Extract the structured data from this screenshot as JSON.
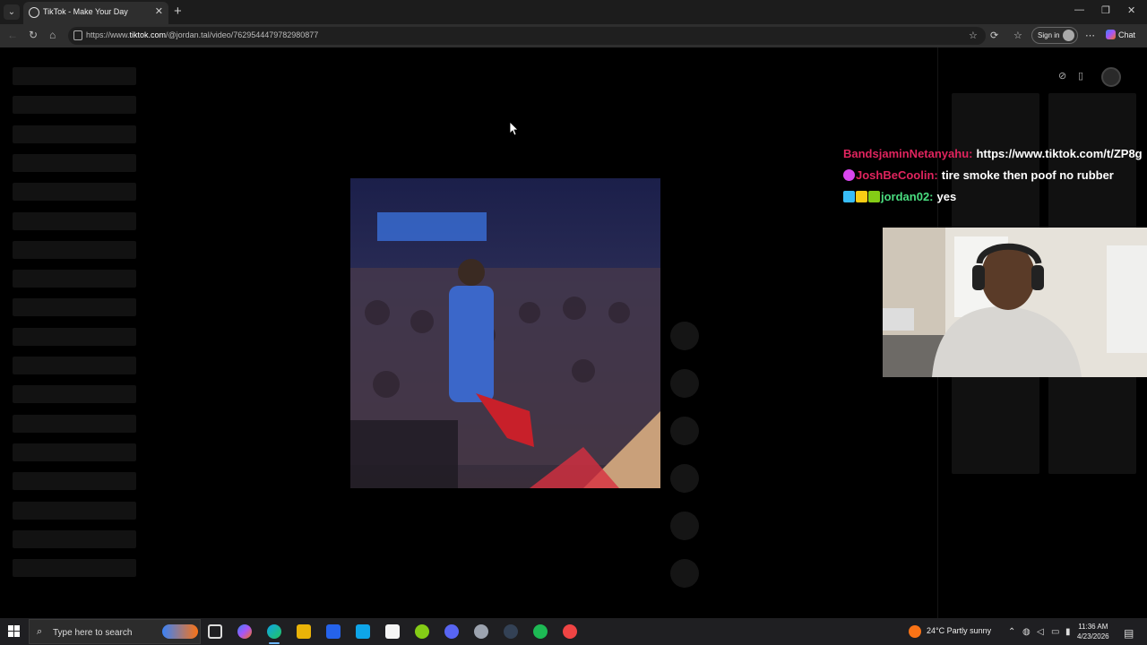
{
  "browser": {
    "tab_title": "TikTok - Make Your Day",
    "url_prefix": "https://www.",
    "url_domain": "tiktok.com",
    "url_path": "/@jordan.tal/video/7629544479782980877",
    "sign_in_label": "Sign in",
    "chat_label": "Chat"
  },
  "chat_overlay": [
    {
      "user": "BandsjaminNetanyahu:",
      "message": "https://www.tiktok.com/t/ZP8g",
      "color": "#e0245e",
      "badges": []
    },
    {
      "user": "JoshBeCoolin:",
      "message": "tire smoke then poof no rubber",
      "color": "#e0245e",
      "badges": [
        "#d946ef"
      ]
    },
    {
      "user": "jordan02:",
      "message": "yes",
      "color": "#4ade80",
      "badges": [
        "#38bdf8",
        "#facc15",
        "#84cc16"
      ]
    }
  ],
  "taskbar": {
    "search_placeholder": "Type here to search",
    "weather": "24°C  Partly sunny",
    "time": "11:36 AM",
    "date": "4/23/2026"
  }
}
